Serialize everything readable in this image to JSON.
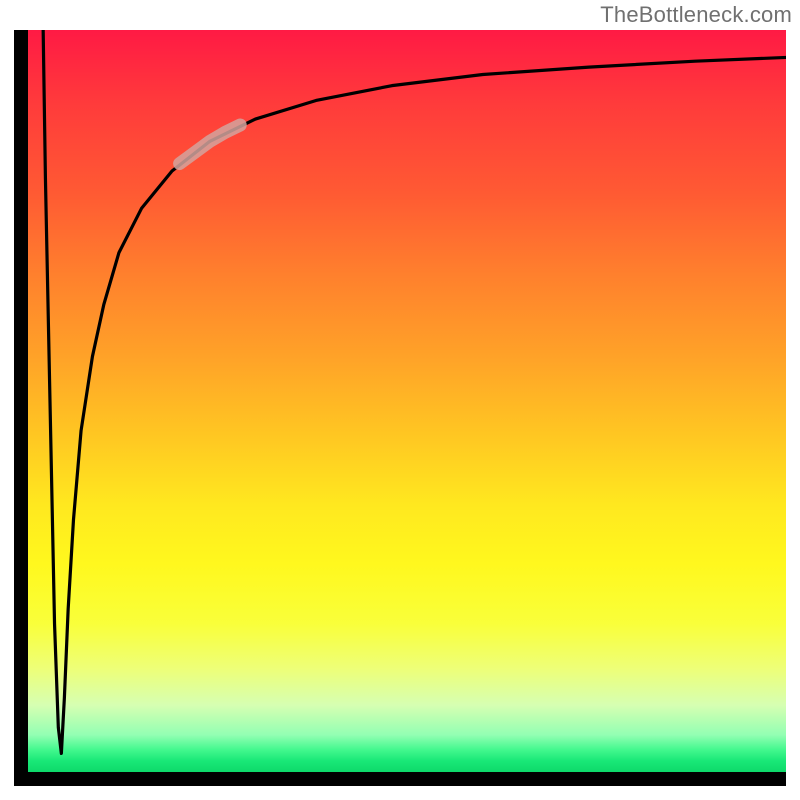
{
  "watermark": "TheBottleneck.com",
  "chart_data": {
    "type": "line",
    "title": "",
    "xlabel": "",
    "ylabel": "",
    "xlim": [
      0,
      100
    ],
    "ylim": [
      0,
      100
    ],
    "grid": false,
    "legend": false,
    "background_gradient": {
      "direction": "vertical",
      "stops": [
        {
          "pos": 0.0,
          "color": "#ff1a44"
        },
        {
          "pos": 0.33,
          "color": "#ff802d"
        },
        {
          "pos": 0.64,
          "color": "#ffe81f"
        },
        {
          "pos": 0.95,
          "color": "#93ffb3"
        },
        {
          "pos": 1.0,
          "color": "#0dd96a"
        }
      ]
    },
    "series": [
      {
        "name": "bottleneck-curve-left",
        "color": "#000000",
        "x": [
          2.0,
          2.3,
          2.7,
          3.1,
          3.5,
          4.0,
          4.4
        ],
        "y": [
          100,
          80,
          60,
          40,
          20,
          6,
          2.5
        ]
      },
      {
        "name": "bottleneck-curve-right",
        "color": "#000000",
        "x": [
          4.4,
          4.8,
          5.3,
          6.0,
          7.0,
          8.5,
          10,
          12,
          15,
          19,
          24,
          30,
          38,
          48,
          60,
          74,
          88,
          100
        ],
        "y": [
          2.5,
          10,
          22,
          34,
          46,
          56,
          63,
          70,
          76,
          81,
          85,
          88,
          90.5,
          92.5,
          94,
          95,
          95.8,
          96.3
        ]
      },
      {
        "name": "highlight-segment",
        "color": "#d4a39e",
        "stroke_width": 10,
        "opacity": 0.85,
        "x": [
          20,
          22,
          24,
          26,
          28
        ],
        "y": [
          82,
          83.5,
          85,
          86.2,
          87.2
        ]
      }
    ],
    "annotations": []
  }
}
